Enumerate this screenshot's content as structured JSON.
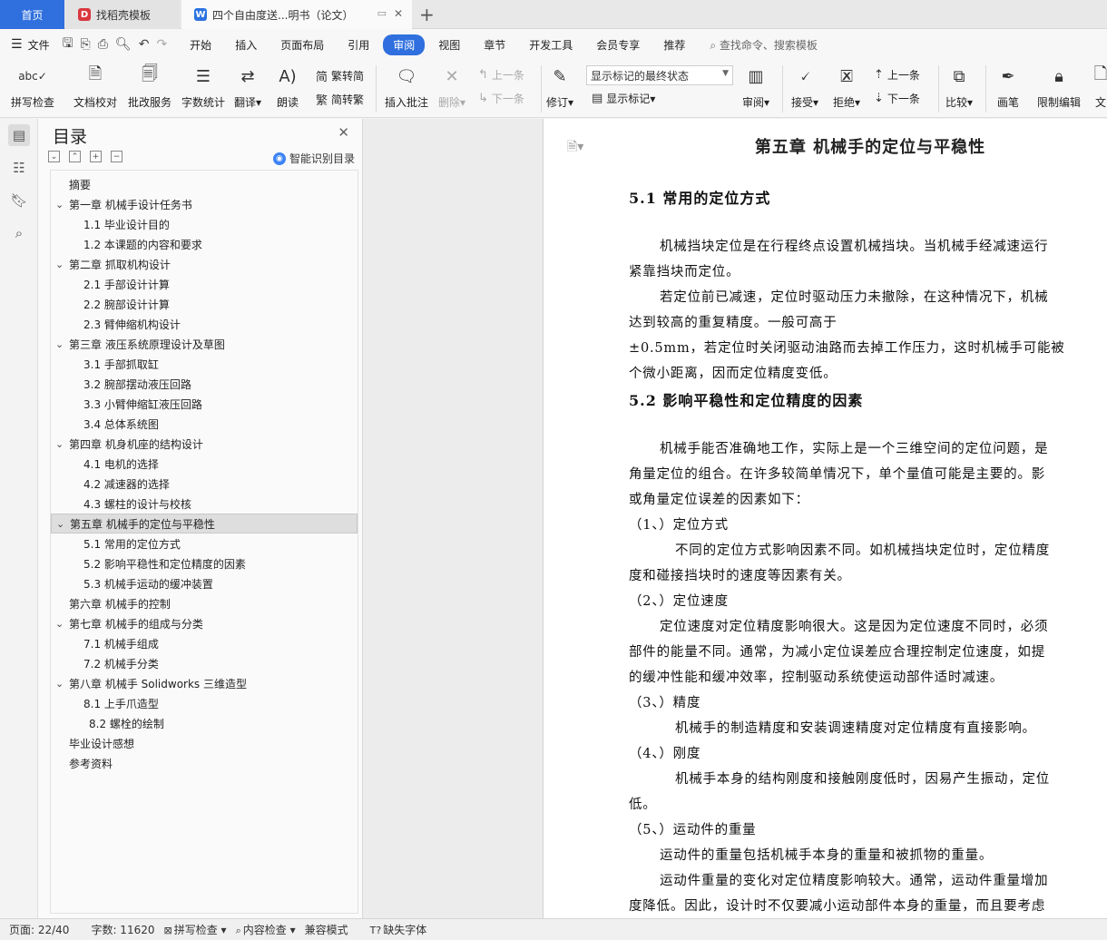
{
  "tabs": {
    "home": "首页",
    "template": "找稻壳模板",
    "document": "四个自由度送...明书（论文）"
  },
  "menubar": {
    "file": "文件",
    "items": [
      "开始",
      "插入",
      "页面布局",
      "引用",
      "审阅",
      "视图",
      "章节",
      "开发工具",
      "会员专享",
      "推荐"
    ],
    "active": "审阅",
    "search": "查找命令、搜索模板"
  },
  "ribbon": {
    "spellcheck": "拼写检查",
    "doc_proof": "文档校对",
    "batch_service": "批改服务",
    "word_count": "字数统计",
    "translate": "翻译",
    "read_aloud": "朗读",
    "trad_to_simp": "繁转简",
    "simp_to_trad": "简转繁",
    "insert_comment": "插入批注",
    "delete": "删除",
    "prev": "上一条",
    "next": "下一条",
    "revise": "修订",
    "markup_select": "显示标记的最终状态",
    "show_markup": "显示标记",
    "review": "审阅",
    "accept": "接受",
    "reject": "拒绝",
    "prev2": "上一条",
    "next2": "下一条",
    "compare": "比较",
    "pen": "画笔",
    "restrict_edit": "限制编辑",
    "doc_cut": "文"
  },
  "toc": {
    "title": "目录",
    "smart": "智能识别目录",
    "items": [
      {
        "text": "摘要",
        "level": 1,
        "chev": false
      },
      {
        "text": "第一章  机械手设计任务书",
        "level": 1,
        "chev": true
      },
      {
        "text": "1.1 毕业设计目的",
        "level": 2,
        "chev": false
      },
      {
        "text": "1.2 本课题的内容和要求",
        "level": 2,
        "chev": false
      },
      {
        "text": "第二章  抓取机构设计",
        "level": 1,
        "chev": true
      },
      {
        "text": "2.1 手部设计计算",
        "level": 2,
        "chev": false
      },
      {
        "text": "2.2 腕部设计计算",
        "level": 2,
        "chev": false
      },
      {
        "text": "2.3 臂伸缩机构设计",
        "level": 2,
        "chev": false
      },
      {
        "text": "第三章  液压系统原理设计及草图",
        "level": 1,
        "chev": true
      },
      {
        "text": "3.1 手部抓取缸",
        "level": 2,
        "chev": false
      },
      {
        "text": "3.2 腕部摆动液压回路",
        "level": 2,
        "chev": false
      },
      {
        "text": "3.3 小臂伸缩缸液压回路",
        "level": 2,
        "chev": false
      },
      {
        "text": "3.4 总体系统图",
        "level": 2,
        "chev": false
      },
      {
        "text": "第四章  机身机座的结构设计",
        "level": 1,
        "chev": true
      },
      {
        "text": "4.1 电机的选择",
        "level": 2,
        "chev": false
      },
      {
        "text": "4.2 减速器的选择",
        "level": 2,
        "chev": false
      },
      {
        "text": "4.3 螺柱的设计与校核",
        "level": 2,
        "chev": false
      },
      {
        "text": "第五章  机械手的定位与平稳性",
        "level": 1,
        "chev": true,
        "selected": true
      },
      {
        "text": "5.1 常用的定位方式",
        "level": 2,
        "chev": false
      },
      {
        "text": "5.2 影响平稳性和定位精度的因素",
        "level": 2,
        "chev": false
      },
      {
        "text": "5.3 机械手运动的缓冲装置",
        "level": 2,
        "chev": false
      },
      {
        "text": "第六章  机械手的控制",
        "level": 1,
        "chev": false
      },
      {
        "text": "第七章  机械手的组成与分类",
        "level": 1,
        "chev": true
      },
      {
        "text": "7.1 机械手组成",
        "level": 2,
        "chev": false
      },
      {
        "text": "7.2 机械手分类",
        "level": 2,
        "chev": false
      },
      {
        "text": "第八章  机械手 Solidworks 三维造型",
        "level": 1,
        "chev": true
      },
      {
        "text": "8.1 上手爪造型",
        "level": 2,
        "chev": false
      },
      {
        "text": "8.2 螺栓的绘制",
        "level": 3,
        "chev": false
      },
      {
        "text": "毕业设计感想",
        "level": 1,
        "chev": false
      },
      {
        "text": "参考资料",
        "level": 1,
        "chev": false
      }
    ]
  },
  "document": {
    "chapter_title": "第五章  机械手的定位与平稳性",
    "lines": [
      {
        "text": "5.1 常用的定位方式",
        "heading": true
      },
      {
        "text": "机械挡块定位是在行程终点设置机械挡块。当机械手经减速运行",
        "indent": 2
      },
      {
        "text": "紧靠挡块而定位。",
        "indent": 0
      },
      {
        "text": "若定位前已减速，定位时驱动压力未撤除，在这种情况下，机械",
        "indent": 2
      },
      {
        "text": "达到较高的重复精度。一般可高于",
        "indent": 0
      },
      {
        "text": "±0.5mm，若定位时关闭驱动油路而去掉工作压力，这时机械手可能被",
        "indent": 0
      },
      {
        "text": "个微小距离，因而定位精度变低。",
        "indent": 0
      },
      {
        "text": "5.2 影响平稳性和定位精度的因素",
        "heading": true
      },
      {
        "text": "机械手能否准确地工作，实际上是一个三维空间的定位问题，是",
        "indent": 2
      },
      {
        "text": "角量定位的组合。在许多较简单情况下，单个量值可能是主要的。影",
        "indent": 0
      },
      {
        "text": "或角量定位误差的因素如下：",
        "indent": 0
      },
      {
        "text": "（1、）定位方式",
        "indent": 0
      },
      {
        "text": "不同的定位方式影响因素不同。如机械挡块定位时，定位精度",
        "indent": 3
      },
      {
        "text": "度和碰接挡块时的速度等因素有关。",
        "indent": 0
      },
      {
        "text": "（2、）定位速度",
        "indent": 0
      },
      {
        "text": "定位速度对定位精度影响很大。这是因为定位速度不同时，必须",
        "indent": 2
      },
      {
        "text": "部件的能量不同。通常，为减小定位误差应合理控制定位速度，如提",
        "indent": 0
      },
      {
        "text": "的缓冲性能和缓冲效率，控制驱动系统使运动部件适时减速。",
        "indent": 0
      },
      {
        "text": "（3、）精度",
        "indent": 0
      },
      {
        "text": "机械手的制造精度和安装调速精度对定位精度有直接影响。",
        "indent": 3
      },
      {
        "text": "（4、）刚度",
        "indent": 0
      },
      {
        "text": "机械手本身的结构刚度和接触刚度低时，因易产生振动，定位",
        "indent": 3
      },
      {
        "text": "低。",
        "indent": 0
      },
      {
        "text": "（5、）运动件的重量",
        "indent": 0
      },
      {
        "text": "运动件的重量包括机械手本身的重量和被抓物的重量。",
        "indent": 2
      },
      {
        "text": "运动件重量的变化对定位精度影响较大。通常，运动件重量增加",
        "indent": 2
      },
      {
        "text": "度降低。因此，设计时不仅要减小运动部件本身的重量，而且要考虑",
        "indent": 0
      }
    ]
  },
  "status": {
    "page": "页面: 22/40",
    "words": "字数: 11620",
    "spell": "拼写检查",
    "content": "内容检查",
    "compat": "兼容模式",
    "missing_font": "缺失字体"
  }
}
